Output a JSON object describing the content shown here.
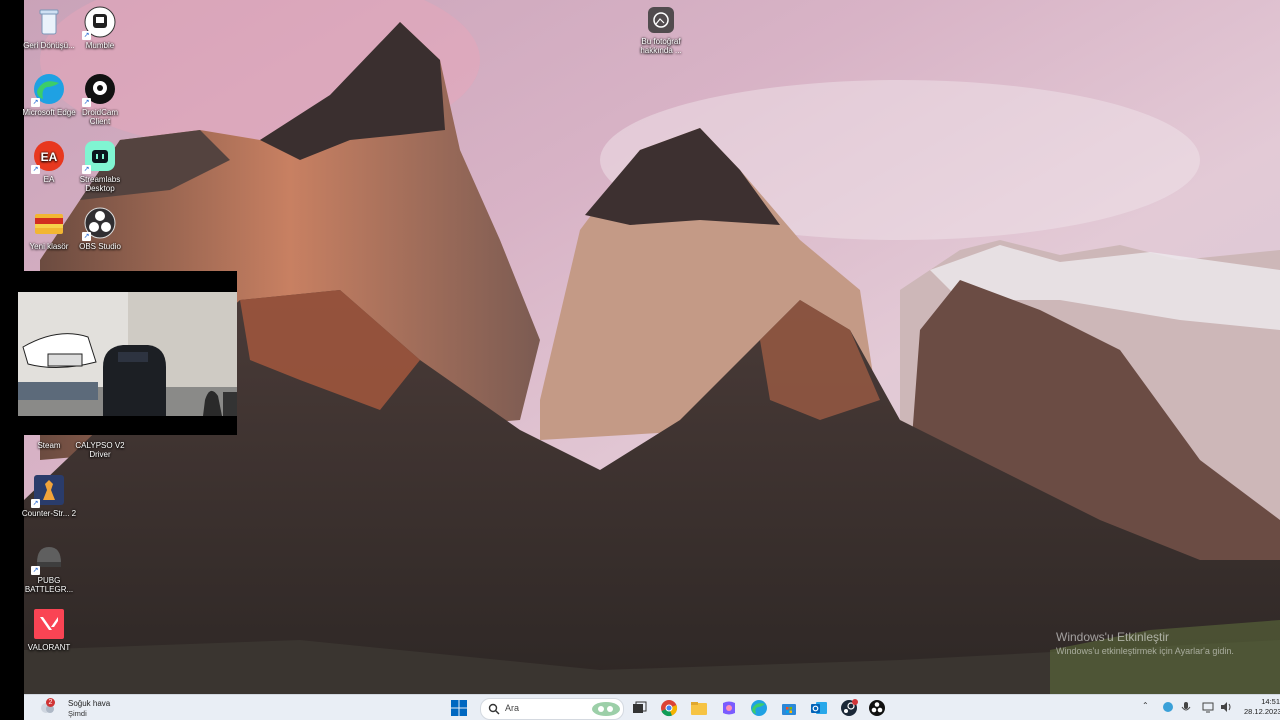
{
  "desktop": {
    "icons": [
      {
        "label": "Geri Dönüşü...",
        "icon": "recycle-bin-icon"
      },
      {
        "label": "Mumble",
        "icon": "mumble-icon"
      },
      {
        "label": "Microsoft Edge",
        "icon": "edge-icon"
      },
      {
        "label": "DroidCam Client",
        "icon": "droidcam-icon"
      },
      {
        "label": "EA",
        "icon": "ea-icon"
      },
      {
        "label": "Streamlabs Desktop",
        "icon": "streamlabs-icon"
      },
      {
        "label": "Yeni klasör",
        "icon": "folder-icon"
      },
      {
        "label": "OBS Studio",
        "icon": "obs-icon"
      },
      {
        "label": "Steam",
        "icon": "steam-icon"
      },
      {
        "label": "CALYPSO V2 Driver",
        "icon": "calypso-icon"
      },
      {
        "label": "Counter-Str... 2",
        "icon": "counter-strike-icon"
      },
      {
        "label": "PUBG BATTLEGR...",
        "icon": "pubg-icon"
      },
      {
        "label": "VALORANT",
        "icon": "valorant-icon"
      }
    ],
    "photo_info": {
      "label": "Bu fotoğraf hakkında ...",
      "icon": "photo-info-icon"
    },
    "watermark": {
      "line1": "Windows'u Etkinleştir",
      "line2": "Windows'u etkinleştirmek için Ayarlar'a gidin."
    }
  },
  "taskbar": {
    "weather_title": "Soğuk hava",
    "weather_sub": "Şimdi",
    "weather_badge": "2",
    "search_placeholder": "Ara",
    "pinned": [
      "start-icon",
      "search-icon",
      "task-view-icon",
      "chrome-icon",
      "file-explorer-icon",
      "copilot-icon",
      "edge-icon",
      "store-icon",
      "outlook-icon",
      "steam-icon",
      "obs-icon"
    ],
    "time": "14:51",
    "date": "28.12.2023"
  },
  "colors": {
    "taskbar_bg": "#e9eef5",
    "accent": "#0067c0"
  }
}
